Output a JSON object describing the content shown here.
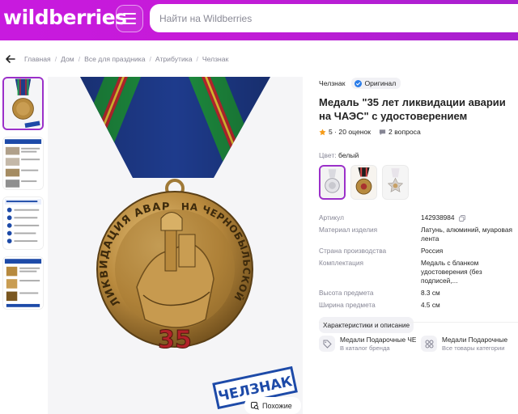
{
  "header": {
    "logo": "wildberries",
    "search_placeholder": "Найти на Wildberries",
    "brand_color": "#c81adf"
  },
  "breadcrumbs": [
    "Главная",
    "Дом",
    "Все для праздника",
    "Атрибутика",
    "Челзнак"
  ],
  "product": {
    "brand": "Челзнак",
    "original_badge": "Оригинал",
    "title": "Медаль \"35 лет ликвидации аварии на ЧАЭС\" с удостоверением",
    "rating": "5",
    "reviews": "20 оценок",
    "questions": "2 вопроса",
    "color_label": "Цвет:",
    "color_value": "белый",
    "image_text": {
      "arc_left": "ЛИКВИДАЦИЯ АВАРИИ",
      "arc_right": "НА ЧЕРНОБЫЛЬСКОЙ АЭС",
      "number": "35",
      "stamp": "ЧЕЛЗНАК"
    },
    "similar_label": "Похожие"
  },
  "specs": [
    {
      "key": "Артикул",
      "value": "142938984"
    },
    {
      "key": "Материал изделия",
      "value": "Латунь, алюминий, муаровая лента"
    },
    {
      "key": "Страна производства",
      "value": "Россия"
    },
    {
      "key": "Комплектация",
      "value": "Медаль с бланком удостоверения (без подписей,..."
    },
    {
      "key": "Высота предмета",
      "value": "8.3 см"
    },
    {
      "key": "Ширина предмета",
      "value": "4.5 см"
    }
  ],
  "chars_button": "Характеристики и описание",
  "brand_cards": [
    {
      "title": "Медали Подарочные ЧЕ",
      "subtitle": "В каталог бренда"
    },
    {
      "title": "Медали Подарочные",
      "subtitle": "Все товары категории"
    }
  ],
  "icons": {
    "menu": "hamburger-icon",
    "back": "back-arrow-icon",
    "original": "check-badge-icon",
    "star": "star-icon",
    "questions": "chat-icon",
    "copy": "copy-icon",
    "similar": "similar-search-icon",
    "brand_card_1": "tag-icon",
    "brand_card_2": "category-icon"
  },
  "colors": {
    "accent_purple": "#9b30c9",
    "star_color": "#f59c1a",
    "muted_text": "#868695"
  }
}
